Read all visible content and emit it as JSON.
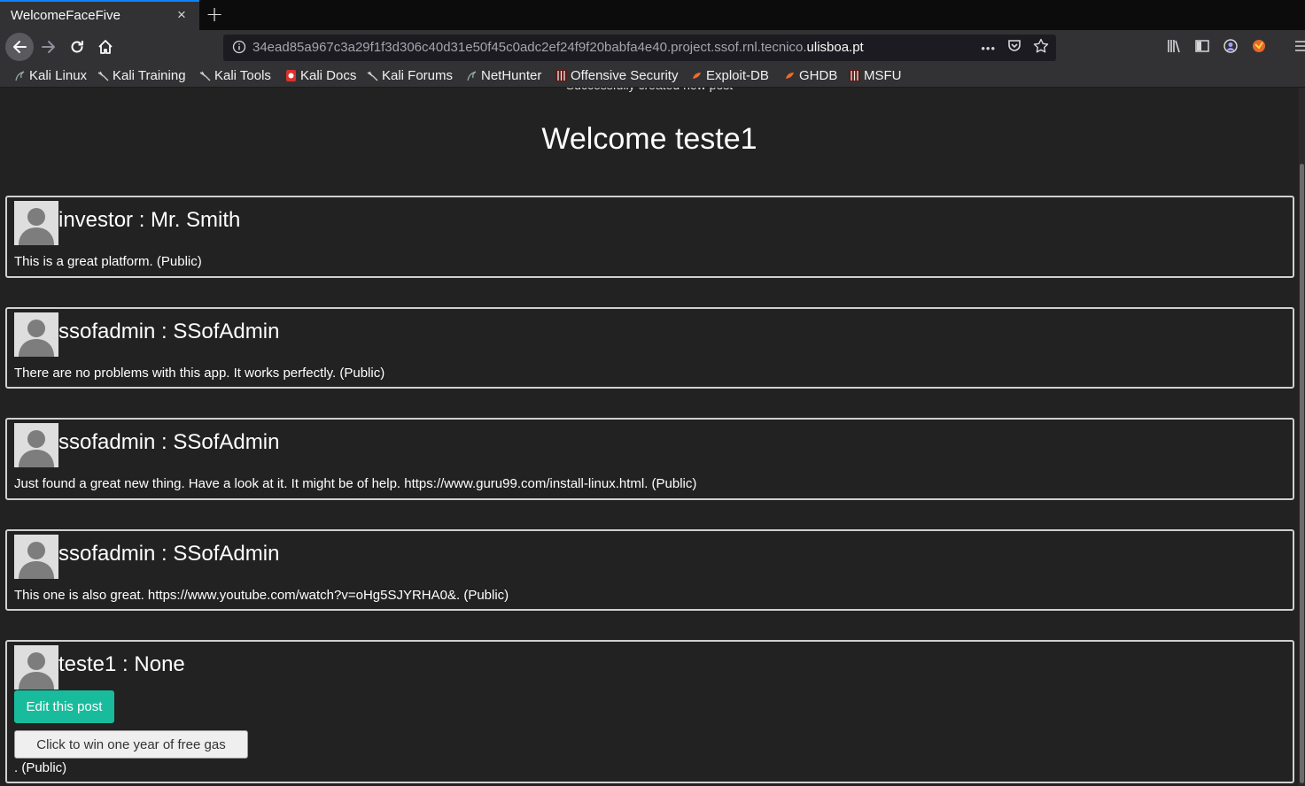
{
  "browser": {
    "tab_title": "WelcomeFaceFive",
    "tab_close": "×",
    "new_tab": "+",
    "url_path": "34ead85a967c3a29f1f3d306c40d31e50f45c0adc2ef24f9f20babfa4e40.project.ssof.rnl.tecnico.",
    "url_host": "ulisboa.pt",
    "url_more": "•••",
    "bookmarks": [
      {
        "label": "Kali Linux",
        "icon": "kali-dragon-icon"
      },
      {
        "label": "Kali Training",
        "icon": "kali-dragon-icon"
      },
      {
        "label": "Kali Tools",
        "icon": "kali-dragon-icon"
      },
      {
        "label": "Kali Docs",
        "icon": "kali-docs-icon"
      },
      {
        "label": "Kali Forums",
        "icon": "kali-dragon-icon"
      },
      {
        "label": "NetHunter",
        "icon": "kali-dragon-icon"
      },
      {
        "label": "Offensive Security",
        "icon": "offsec-icon"
      },
      {
        "label": "Exploit-DB",
        "icon": "exploitdb-icon"
      },
      {
        "label": "GHDB",
        "icon": "exploitdb-icon"
      },
      {
        "label": "MSFU",
        "icon": "offsec-icon"
      }
    ]
  },
  "page": {
    "flash_message": "Successfully created new post",
    "welcome": "Welcome teste1",
    "posts": [
      {
        "author": "investor : Mr. Smith",
        "content": "This is a great platform. (Public)"
      },
      {
        "author": "ssofadmin : SSofAdmin",
        "content": "There are no problems with this app. It works perfectly. (Public)"
      },
      {
        "author": "ssofadmin : SSofAdmin",
        "content": "Just found a great new thing. Have a look at it. It might be of help. https://www.guru99.com/install-linux.html. (Public)"
      },
      {
        "author": "ssofadmin : SSofAdmin",
        "content": "This one is also great. https://www.youtube.com/watch?v=oHg5SJYRHA0&. (Public)"
      },
      {
        "author": "teste1 : None",
        "edit_label": "Edit this post",
        "gas_button": "Click to win one year of free gas",
        "content": ". (Public)"
      }
    ]
  },
  "colors": {
    "page_background": "#222222",
    "accent_button": "#18bc9c",
    "tab_highlight": "#0a84ff"
  }
}
